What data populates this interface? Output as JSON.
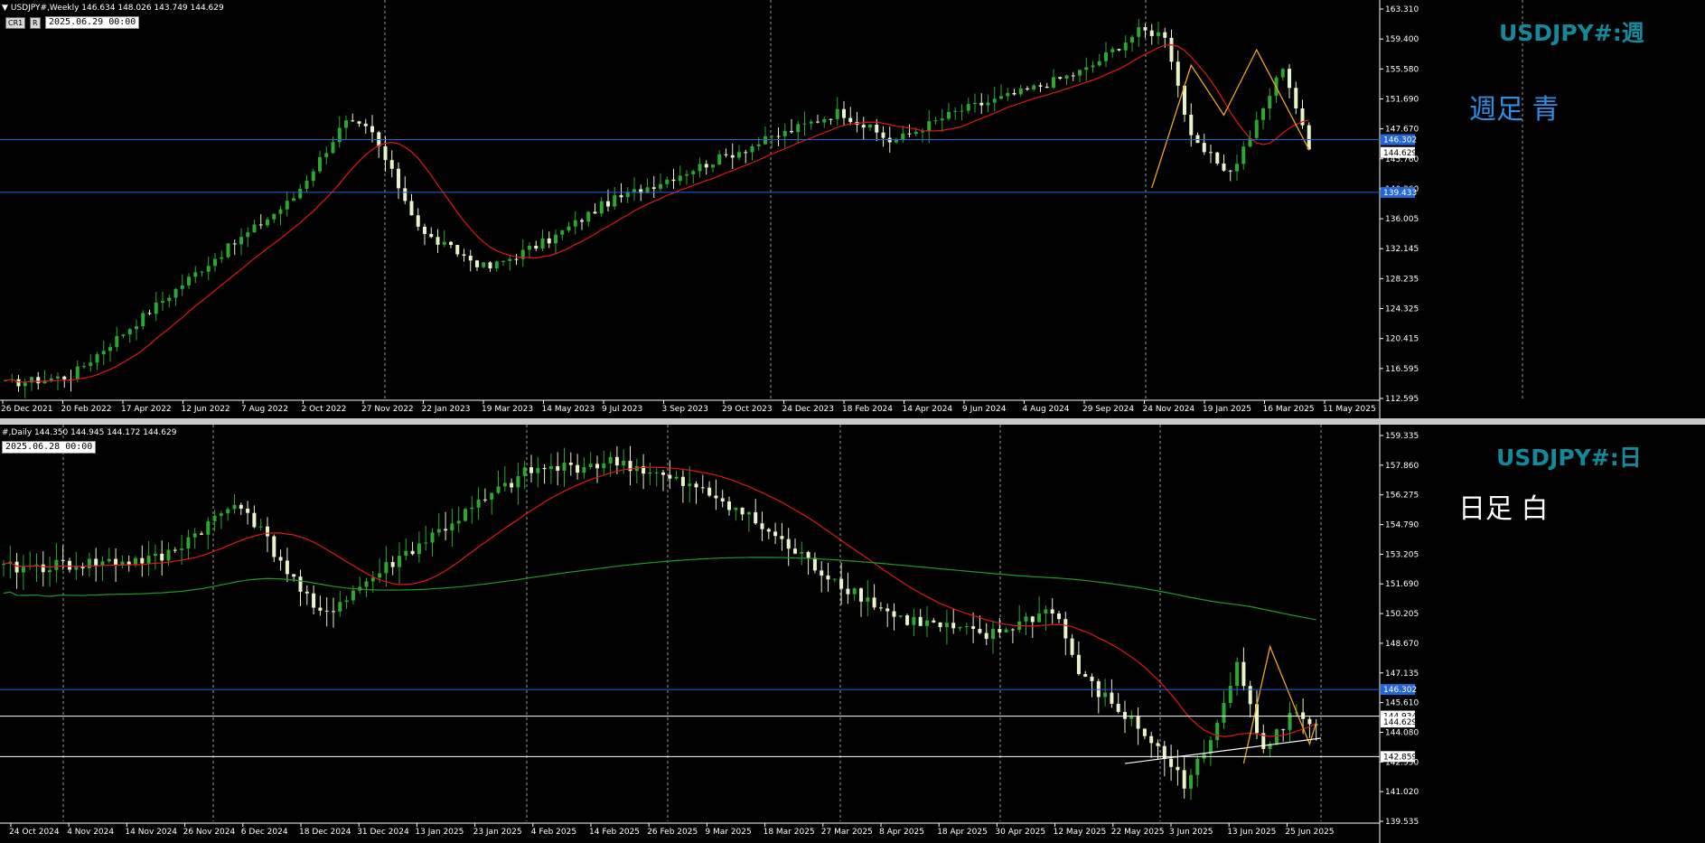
{
  "weekly": {
    "header": "USDJPY#,Weekly  146.634 148.026 143.749 144.629",
    "datetime": "2025.06.29 00:00",
    "buttons": [
      "CR1",
      "R"
    ],
    "symbol_label": "USDJPY#:週",
    "note": "週足  青",
    "colors": {
      "label": "#138a9b",
      "note": "#2a8fe8",
      "ma": "#e11616",
      "zigzag": "#f0a818",
      "hline": "#2466d6"
    },
    "price_labels": [
      "163.310",
      "159.400",
      "155.580",
      "151.690",
      "147.670",
      "145.760",
      "140.360",
      "136.005",
      "132.145",
      "128.235",
      "124.325",
      "120.415",
      "116.595",
      "112.595"
    ],
    "hlines": [
      {
        "price": "146.302",
        "color": "#2466d6"
      },
      {
        "price": "139.433",
        "color": "#2466d6"
      }
    ],
    "current_price": "144.629",
    "date_labels": [
      "26 Dec 2021",
      "20 Feb 2022",
      "17 Apr 2022",
      "12 Jun 2022",
      "7 Aug 2022",
      "2 Oct 2022",
      "27 Nov 2022",
      "22 Jan 2023",
      "19 Mar 2023",
      "14 May 2023",
      "9 Jul 2023",
      "3 Sep 2023",
      "29 Oct 2023",
      "24 Dec 2023",
      "18 Feb 2024",
      "14 Apr 2024",
      "9 Jun 2024",
      "4 Aug 2024",
      "29 Sep 2024",
      "24 Nov 2024",
      "19 Jan 2025",
      "16 Mar 2025",
      "11 May 2025"
    ]
  },
  "daily": {
    "header": "#,Daily  144.350 144.945 144.172 144.629",
    "datetime": "2025.06.28 00:00",
    "symbol_label": "USDJPY#:日",
    "note": "日足  白",
    "colors": {
      "label": "#138a9b",
      "note": "#ffffff",
      "ma": "#e11616",
      "ma_long": "#1f9a2a",
      "zigzag": "#f0a818",
      "hline": "#2466d6",
      "hline2": "#ffffff"
    },
    "price_labels": [
      "159.335",
      "157.860",
      "156.275",
      "154.790",
      "153.205",
      "151.690",
      "150.205",
      "148.670",
      "147.135",
      "145.610",
      "144.080",
      "142.550",
      "141.020",
      "139.535"
    ],
    "hlines": [
      {
        "price": "146.302",
        "color": "#2466d6"
      },
      {
        "price": "144.934",
        "color": "#ffffff"
      },
      {
        "price": "142.859",
        "color": "#ffffff"
      }
    ],
    "current_price": "144.629",
    "date_labels": [
      "24 Oct 2024",
      "4 Nov 2024",
      "14 Nov 2024",
      "26 Nov 2024",
      "6 Dec 2024",
      "18 Dec 2024",
      "31 Dec 2024",
      "13 Jan 2025",
      "23 Jan 2025",
      "4 Feb 2025",
      "14 Feb 2025",
      "26 Feb 2025",
      "9 Mar 2025",
      "18 Mar 2025",
      "27 Mar 2025",
      "8 Apr 2025",
      "18 Apr 2025",
      "30 Apr 2025",
      "12 May 2025",
      "22 May 2025",
      "3 Jun 2025",
      "13 Jun 2025",
      "25 Jun 2025"
    ]
  }
}
